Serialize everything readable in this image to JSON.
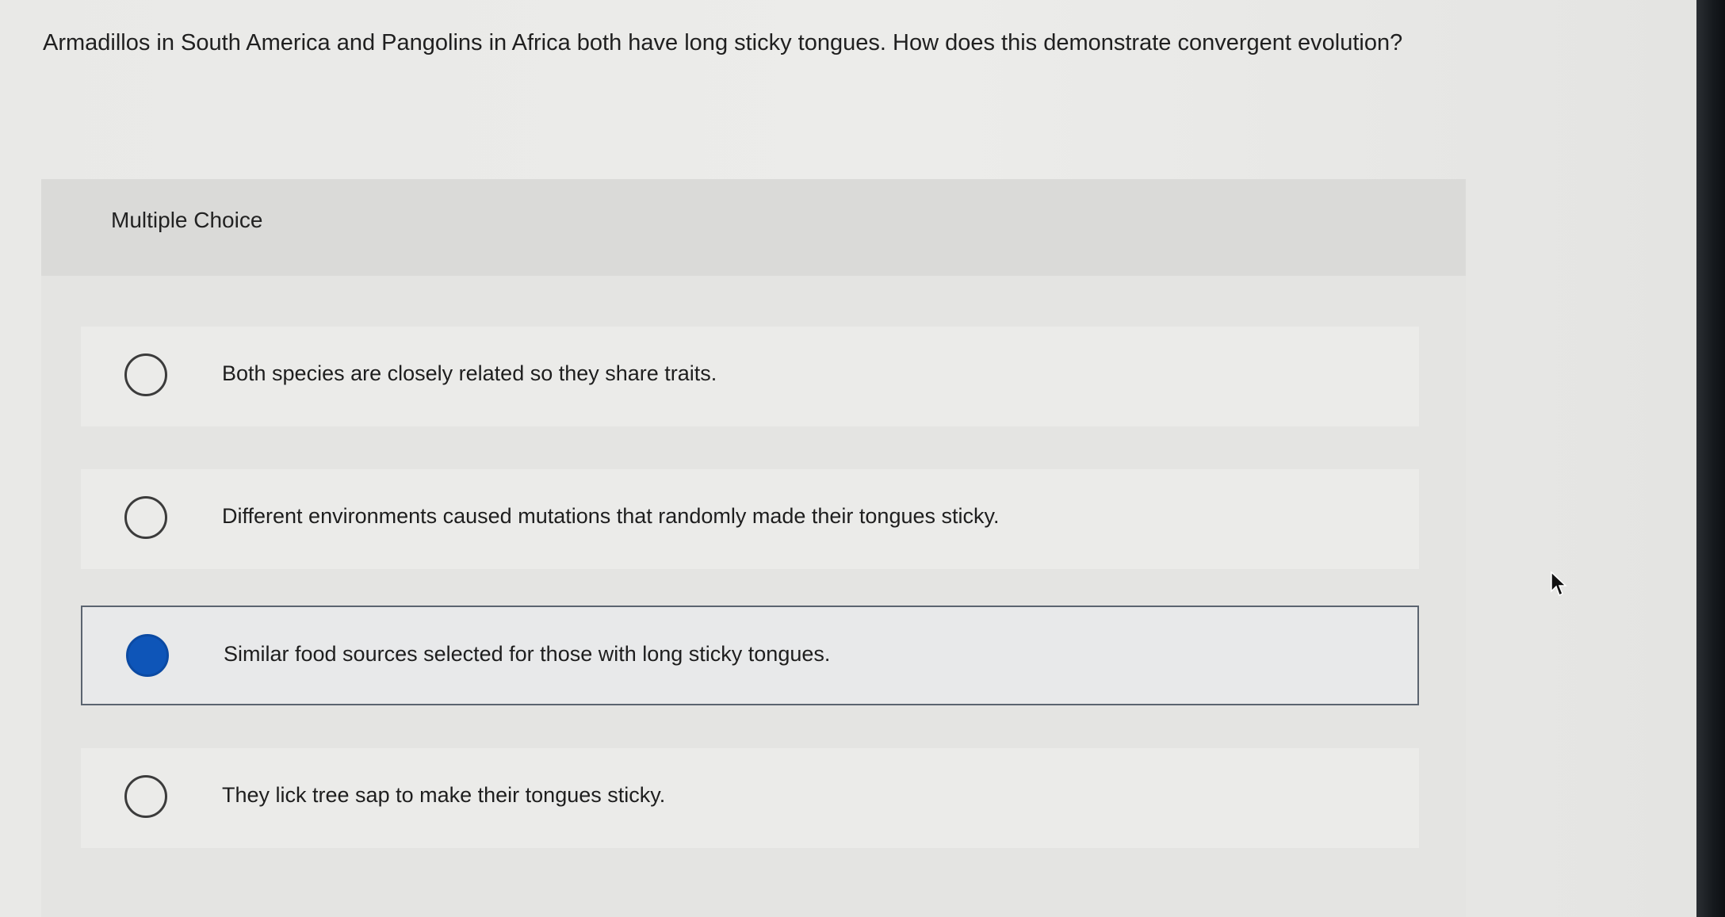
{
  "question": {
    "text": "Armadillos in South America and Pangolins in Africa both have long sticky tongues. How does this demonstrate convergent evolution?"
  },
  "multiple_choice": {
    "label": "Multiple Choice",
    "options": [
      {
        "text": "Both species are closely related so they share traits.",
        "selected": false
      },
      {
        "text": "Different environments caused mutations that randomly made their tongues sticky.",
        "selected": false
      },
      {
        "text": "Similar food sources selected for those with long sticky tongues.",
        "selected": true
      },
      {
        "text": "They lick tree sap to make their tongues sticky.",
        "selected": false
      }
    ]
  },
  "colors": {
    "selected_radio": "#0e55b8",
    "selected_border": "#5b6470"
  },
  "icons": {
    "cursor": "mouse-pointer-icon"
  }
}
